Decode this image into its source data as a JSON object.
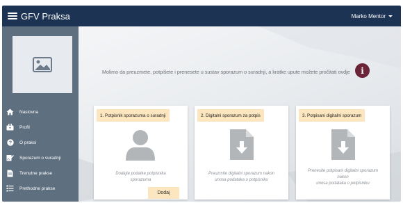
{
  "app": {
    "brand": "GFV Praksa",
    "user_name": "Marko Mentor"
  },
  "sidebar": {
    "items": [
      {
        "label": "Naslovna",
        "icon": "home-icon"
      },
      {
        "label": "Profil",
        "icon": "briefcase-icon"
      },
      {
        "label": "O praksi",
        "icon": "question-icon"
      },
      {
        "label": "Sporazum o suradnji",
        "icon": "signature-icon"
      },
      {
        "label": "Trenutne prakse",
        "icon": "document-icon"
      },
      {
        "label": "Prethodne prakse",
        "icon": "list-icon"
      }
    ]
  },
  "main": {
    "info_text": "Molimo da preuzmete, potpišete i prenesete u sustav sporazum o suradnji, a kratke upute možete pročitati ovdje",
    "cards": [
      {
        "title": "1. Potpisnik sporazuma o suradnji",
        "body": [
          "Dodajte podatke potpisnika",
          "sporazuma"
        ],
        "button": "Dodaj",
        "icon": "user-icon"
      },
      {
        "title": "2. Digitalni sporazum za potpis",
        "body": [
          "Preuzmite digitalni sporazum nakon",
          "unosa podataka o potpisniku"
        ],
        "icon": "file-download-icon"
      },
      {
        "title": "3. Potpisani digitalni sporazum",
        "body": [
          "Prenesite potpisani digitalni sporazum",
          "nakon",
          "unosa podataka o potpisniku"
        ],
        "icon": "file-download-icon"
      }
    ]
  },
  "colors": {
    "topbar": "#1d3353",
    "sidebar": "#5e6f80",
    "card_header": "#fbe6bf",
    "info_button": "#6b2438"
  }
}
